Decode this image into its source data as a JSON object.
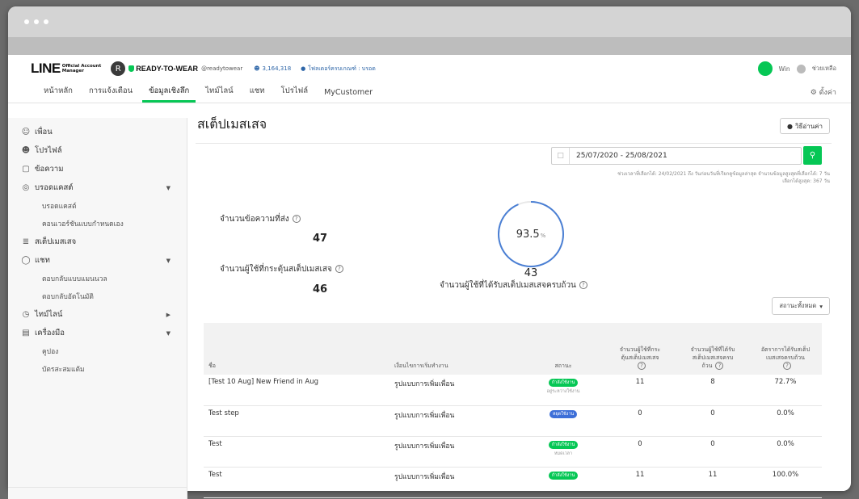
{
  "brand": {
    "logo": "LINE",
    "logo_sub_1": "Official Account",
    "logo_sub_2": "Manager"
  },
  "account": {
    "avatar_letter": "R",
    "name": "READY-TO-WEAR",
    "id": "@readytowear",
    "friends": "3,164,318",
    "plan": "โฟลเดอร์ครบเกณฑ์ : บรอด"
  },
  "top_right": {
    "user": "Win",
    "help": "ช่วยเหลือ"
  },
  "tabs": [
    "หน้าหลัก",
    "การแจ้งเตือน",
    "ข้อมูลเชิงลึก",
    "ไทม์ไลน์",
    "แชท",
    "โปรไฟล์",
    "MyCustomer"
  ],
  "tab_right": "ตั้งค่า",
  "sidebar": {
    "friends": "เพื่อน",
    "profile": "โปรไฟล์",
    "messages": "ข้อความ",
    "broadcast": "บรอดแคสต์",
    "broadcast_sub": "บรอดแคสต์",
    "broadcast_sub2": "คอนเวอร์ชันแบบกำหนดเอง",
    "step": "สเต็ปเมสเสจ",
    "chat": "แชท",
    "chat_sub": "ตอบกลับแบบแมนนวล",
    "chat_sub2": "ตอบกลับอัตโนมัติ",
    "timeline": "ไทม์ไลน์",
    "tools": "เครื่องมือ",
    "tools_sub": "คูปอง",
    "tools_sub2": "บัตรสะสมแต้ม"
  },
  "main": {
    "title": "สเต็ปเมสเสจ",
    "howto": "วิธีอ่านค่า",
    "date_range": "25/07/2020 - 25/08/2021",
    "note_1": "ช่วงเวลาที่เลือกได้: 24/02/2021 ถึง วันก่อนวันที่เรียกดูข้อมูลล่าสุด จำนวนข้อมูลสูงสุดที่เลือกได้: 7 วัน",
    "note_2": "เลือกได้สูงสุด: 367 วัน",
    "sent_label": "จำนวนข้อความที่ส่ง",
    "sent_value": "47",
    "triggered_label": "จำนวนผู้ใช้ที่กระตุ้นสเต็ปเมสเสจ",
    "triggered_value": "46",
    "completion_rate": "93.5",
    "completion_unit": "%",
    "completion_fraction": 0.935,
    "completed_value": "43",
    "completed_label": "จำนวนผู้ใช้ที่ได้รับสเต็ปเมสเสจครบถ้วน",
    "filter": "สถานะทั้งหมด"
  },
  "table": {
    "headers": {
      "name": "ชื่อ",
      "condition": "เงื่อนไขการเริ่มทำงาน",
      "status": "สถานะ",
      "triggered_1": "จำนวนผู้ใช้ที่กระ",
      "triggered_2": "ตุ้นสเต็ปเมสเสจ",
      "completed_1": "จำนวนผู้ใช้ที่ได้รับ",
      "completed_2": "สเต็ปเมสเสจครบ",
      "completed_3": "ถ้วน",
      "rate_1": "อัตราการได้รับสเต็ป",
      "rate_2": "เมสเสจครบถ้วน"
    },
    "rows": [
      {
        "name": "[Test 10 Aug] New Friend in Aug",
        "condition": "รูปแบบการเพิ่มเพื่อน",
        "status": "กำลังใช้งาน",
        "status_sub": "อยู่ระหว่างใช้งาน",
        "triggered": "11",
        "completed": "8",
        "rate": "72.7%"
      },
      {
        "name": "Test step",
        "condition": "รูปแบบการเพิ่มเพื่อน",
        "status": "หยุดใช้งาน",
        "status_sub": "",
        "triggered": "0",
        "completed": "0",
        "rate": "0.0%"
      },
      {
        "name": "Test",
        "condition": "รูปแบบการเพิ่มเพื่อน",
        "status": "กำลังใช้งาน",
        "status_sub": "หมดเวลา",
        "triggered": "0",
        "completed": "0",
        "rate": "0.0%"
      },
      {
        "name": "Test",
        "condition": "รูปแบบการเพิ่มเพื่อน",
        "status": "กำลังใช้งาน",
        "status_sub": "",
        "triggered": "11",
        "completed": "11",
        "rate": "100.0%"
      }
    ]
  },
  "colors": {
    "brand_green": "#06c755",
    "ring_blue": "#4a7fd4",
    "paused_blue": "#3d6fd8"
  }
}
